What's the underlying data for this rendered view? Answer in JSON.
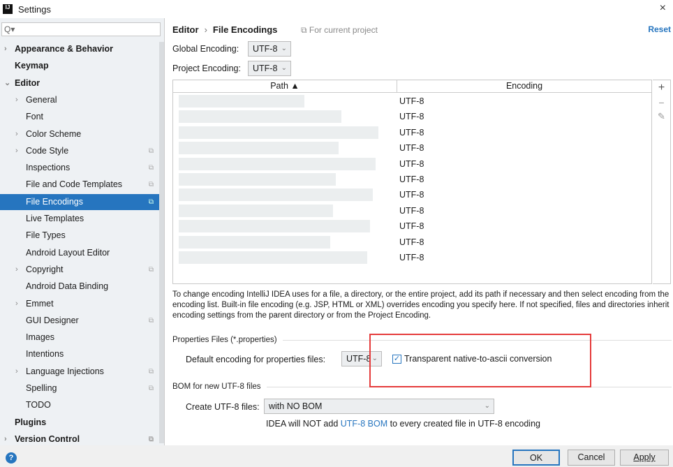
{
  "window": {
    "title": "Settings",
    "close": "×",
    "logo": "IJ"
  },
  "sidebar": {
    "search_placeholder": "Q▾",
    "items": [
      {
        "label": "Appearance & Behavior",
        "level": 0,
        "arrow": "›",
        "bold": true
      },
      {
        "label": "Keymap",
        "level": 0,
        "bold": true
      },
      {
        "label": "Editor",
        "level": 0,
        "arrow": "⌄",
        "bold": true
      },
      {
        "label": "General",
        "level": 1,
        "arrow": "›"
      },
      {
        "label": "Font",
        "level": 1
      },
      {
        "label": "Color Scheme",
        "level": 1,
        "arrow": "›"
      },
      {
        "label": "Code Style",
        "level": 1,
        "arrow": "›",
        "project": true
      },
      {
        "label": "Inspections",
        "level": 1,
        "project": true
      },
      {
        "label": "File and Code Templates",
        "level": 1,
        "project": true
      },
      {
        "label": "File Encodings",
        "level": 1,
        "project": true,
        "selected": true
      },
      {
        "label": "Live Templates",
        "level": 1
      },
      {
        "label": "File Types",
        "level": 1
      },
      {
        "label": "Android Layout Editor",
        "level": 1
      },
      {
        "label": "Copyright",
        "level": 1,
        "arrow": "›",
        "project": true
      },
      {
        "label": "Android Data Binding",
        "level": 1
      },
      {
        "label": "Emmet",
        "level": 1,
        "arrow": "›"
      },
      {
        "label": "GUI Designer",
        "level": 1,
        "project": true
      },
      {
        "label": "Images",
        "level": 1
      },
      {
        "label": "Intentions",
        "level": 1
      },
      {
        "label": "Language Injections",
        "level": 1,
        "arrow": "›",
        "project": true
      },
      {
        "label": "Spelling",
        "level": 1,
        "project": true
      },
      {
        "label": "TODO",
        "level": 1
      },
      {
        "label": "Plugins",
        "level": 0,
        "bold": true
      },
      {
        "label": "Version Control",
        "level": 0,
        "arrow": "›",
        "bold": true,
        "project": true
      }
    ]
  },
  "main": {
    "breadcrumb": {
      "parent": "Editor",
      "sep": "›",
      "current": "File Encodings"
    },
    "for_current_project": "⧉ For current project",
    "reset": "Reset",
    "global_label": "Global Encoding:",
    "global_value": "UTF-8",
    "project_label": "Project Encoding:",
    "project_value": "UTF-8",
    "table": {
      "headers": [
        "Path ▲",
        "Encoding"
      ],
      "rows": [
        "UTF-8",
        "UTF-8",
        "UTF-8",
        "UTF-8",
        "UTF-8",
        "UTF-8",
        "UTF-8",
        "UTF-8",
        "UTF-8",
        "UTF-8",
        "UTF-8"
      ]
    },
    "tools": {
      "add": "+",
      "remove": "−",
      "edit": "✎"
    },
    "help": "To change encoding IntelliJ IDEA uses for a file, a directory, or the entire project, add its path if necessary and then select encoding from the encoding list. Built-in file encoding (e.g. JSP, HTML or XML) overrides encoding you specify here. If not specified, files and directories inherit encoding settings from the parent directory or from the Project Encoding.",
    "properties": {
      "section": "Properties Files (*.properties)",
      "label": "Default encoding for properties files:",
      "value": "UTF-8",
      "checkbox_label": "Transparent native-to-ascii conversion",
      "checked": true
    },
    "bom": {
      "section": "BOM for new UTF-8 files",
      "label": "Create UTF-8 files:",
      "value": "with NO BOM",
      "note_pre": "IDEA will NOT add ",
      "note_link": "UTF-8 BOM",
      "note_post": " to every created file in UTF-8 encoding"
    }
  },
  "footer": {
    "help": "?",
    "ok": "OK",
    "cancel": "Cancel",
    "apply": "Apply"
  },
  "colors": {
    "accent": "#2675bf",
    "highlight": "#e53b3b"
  }
}
